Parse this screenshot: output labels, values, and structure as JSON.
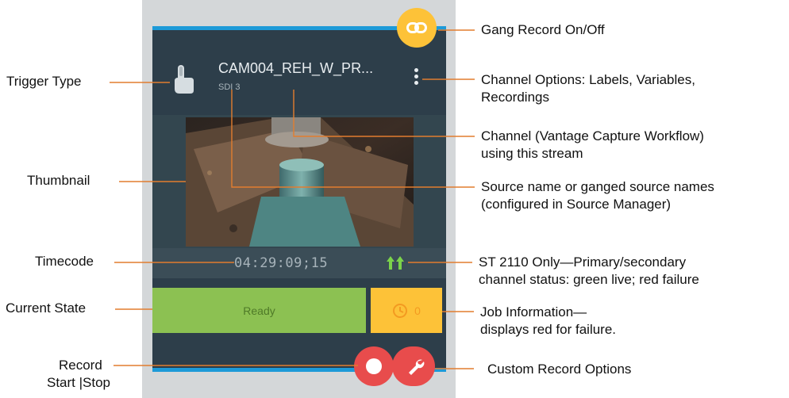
{
  "channel": {
    "name": "CAM004_REH_W_PR...",
    "source": "SDI 3",
    "timecode": "04:29:09;15",
    "state": "Ready",
    "job_count": "0"
  },
  "colors": {
    "accent_blue": "#1d9ad8",
    "panel": "#2d3e4a",
    "ready_green": "#8cc152",
    "job_yellow": "#fdc238",
    "record_red": "#e84c4c",
    "status_green": "#7bd34a"
  },
  "callouts": {
    "trigger_type": "Trigger Type",
    "thumbnail": "Thumbnail",
    "timecode": "Timecode",
    "current_state": "Current State",
    "record_line1": "Record",
    "record_line2": "Start |Stop",
    "gang_record": "Gang Record On/Off",
    "channel_options_1": "Channel Options: Labels, Variables,",
    "channel_options_2": "Recordings",
    "channel_1": "Channel (Vantage Capture Workflow)",
    "channel_2": "using this stream",
    "source_1": "Source name or ganged source names",
    "source_2": "(configured in Source Manager)",
    "st2110_1": "ST 2110 Only—Primary/secondary",
    "st2110_2": "channel status: green live; red failure",
    "job_1": "Job Information—",
    "job_2": "displays red for failure.",
    "custom_record": "Custom Record Options"
  },
  "icons": [
    "link-icon",
    "touch-trigger-icon",
    "kebab-menu-icon",
    "dual-arrow-up-icon",
    "clock-icon",
    "record-dot-icon",
    "wrench-icon"
  ]
}
